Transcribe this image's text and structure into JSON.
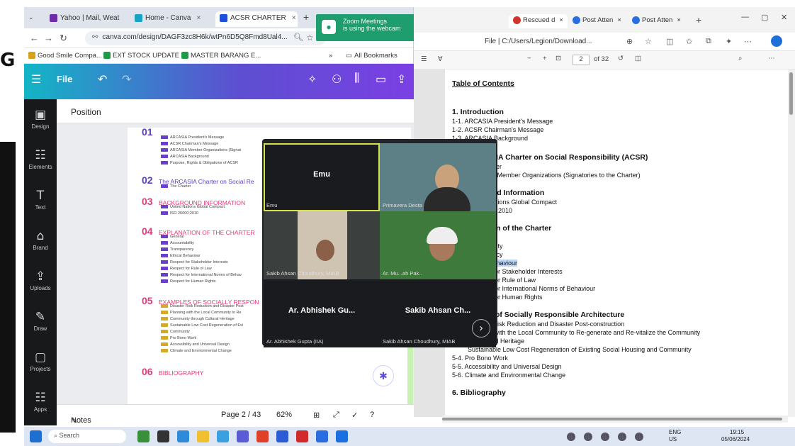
{
  "left_strip": {
    "glyph": "G"
  },
  "chrome": {
    "tabs": [
      {
        "label": "Yahoo | Mail, Weat",
        "icon_color": "#6b2ca8"
      },
      {
        "label": "Home - Canva",
        "icon_color": "#17a3c6"
      },
      {
        "label": "ACSR CHARTER",
        "icon_color": "#1d4fd8"
      }
    ],
    "new_tab": "+",
    "url": "canva.com/design/DAGF3zc8H6k/wtPn6D5Q8Fmd8Ual4...",
    "bookmarks": [
      {
        "label": "Good Smile Compa...",
        "icon_color": "#d9a01a"
      },
      {
        "label": "EXT STOCK UPDATE ...",
        "icon_color": "#1f9a46"
      },
      {
        "label": "MASTER BARANG E...",
        "icon_color": "#1f9a46"
      }
    ],
    "all_bookmarks": "All Bookmarks",
    "bookmarks_more": "»"
  },
  "zoom_notification": {
    "line1": "Zoom Meetings",
    "line2": "is using the webcam"
  },
  "canva": {
    "file_label": "File",
    "panel_title": "Position",
    "side": [
      {
        "label": "Design",
        "glyph": "▣"
      },
      {
        "label": "Elements",
        "glyph": "☷"
      },
      {
        "label": "Text",
        "glyph": "T"
      },
      {
        "label": "Brand",
        "glyph": "⌂"
      },
      {
        "label": "Uploads",
        "glyph": "⇪"
      },
      {
        "label": "Draw",
        "glyph": "✎"
      },
      {
        "label": "Projects",
        "glyph": "▢"
      },
      {
        "label": "Apps",
        "glyph": "☷"
      }
    ],
    "doc": {
      "s01_num": "01",
      "s01_subs": [
        "ARCASIA President's Message",
        "ACSR Chairman's Message",
        "ARCASIA Member Organizations (Signat",
        "ARCASIA Background",
        "Purpose, Rights & Obligations of ACSR"
      ],
      "s02_num": "02",
      "s02_title": "The ARCASIA Charter on Social Re",
      "s02_subs": [
        "The Charter"
      ],
      "s03_num": "03",
      "s03_title": "BACKGROUND INFORMATION",
      "s03_subs": [
        "United Nations Global Compact",
        "ISO 26000:2010"
      ],
      "s04_num": "04",
      "s04_title": "EXPLANATION OF THE CHARTER",
      "s04_subs": [
        "General",
        "Accountability",
        "Transparency",
        "Ethical Behaviour",
        "Respect for Stakeholder Interests",
        "Respect for Rule of Law",
        "Respect for International Norms of Behav",
        "Respect for Human Rights"
      ],
      "s05_num": "05",
      "s05_title": "EXAMPLES OF SOCIALLY RESPON",
      "s05_subs": [
        "Disaster Risk Reduction and Disaster Post",
        "Planning with the Local Community to Re",
        "Community through Cultural Heritage",
        "Sustainable Low Cost Regeneration of Exi",
        "Community",
        "Pro Bono Work",
        "Accessibility and Universal Design",
        "Climate and Environmental Change"
      ],
      "s06_num": "06",
      "s06_title": "BIBLIOGRAPHY"
    },
    "notes": "Notes",
    "page_indicator": "Page 2 / 43",
    "zoom": "62%"
  },
  "edge": {
    "tabs": [
      {
        "label": "Rescued d",
        "icon_color": "#d0342c"
      },
      {
        "label": "Post Atten",
        "icon_color": "#2a6de0"
      },
      {
        "label": "Post Atten",
        "icon_color": "#2a6de0"
      }
    ],
    "url": "File  |  C:/Users/Legion/Download...",
    "page_num": "2",
    "page_of": "of 32",
    "pdf": [
      {
        "t": "Table of Contents",
        "h": true,
        "u": true
      },
      {
        "t": "1. Introduction",
        "h": true
      },
      {
        "t": "1-1. ARCASIA President's Message"
      },
      {
        "t": "1-2. ACSR Chairman's Message"
      },
      {
        "t": "1-3. ARCASIA Background"
      },
      {
        "t": "he ARCASIA Charter on Social Responsibility (ACSR)",
        "h": true
      },
      {
        "t": "The Charter"
      },
      {
        "t": "ARCASIA Member Organizations (Signatories to the Charter)"
      },
      {
        "t": "ackground Information",
        "h": true
      },
      {
        "t": "United Nations Global Compact"
      },
      {
        "t": "SO 26000:2010"
      },
      {
        "t": "xplanation of the Charter",
        "h": true
      },
      {
        "t": "General"
      },
      {
        "t": "ccountability"
      },
      {
        "t": "ransparency"
      },
      {
        "t": "Ethical Behaviour",
        "hl": true
      },
      {
        "t": "Respect for Stakeholder Interests"
      },
      {
        "t": "Respect for Rule of Law"
      },
      {
        "t": "Respect for International Norms of Behaviour"
      },
      {
        "t": "Respect for Human Rights"
      },
      {
        "t": "xamples of Socially Responsible Architecture",
        "h": true
      },
      {
        "t": "Disaster Risk Reduction and Disaster Post-construction"
      },
      {
        "t": "Planning with the Local Community to Re-generate and Re-vitalize the Community"
      },
      {
        "t": "gh Cultural Heritage"
      },
      {
        "t": "Sustainable Low Cost Regeneration of Existing Social Housing and Community"
      },
      {
        "t": "5-4. Pro Bono Work"
      },
      {
        "t": "5-5. Accessibility and Universal Design"
      },
      {
        "t": "5-6. Climate and Environmental Change"
      },
      {
        "t": "6. Bibliography",
        "h": true
      }
    ]
  },
  "gallery": {
    "tiles": [
      {
        "big": "Emu",
        "name": "Emu",
        "kind": "blank",
        "active": true
      },
      {
        "big": "",
        "name": "Primavera Desta",
        "kind": "video"
      },
      {
        "big": "",
        "name": "Sakib Ahsan Choudhury, MIAB",
        "kind": "video"
      },
      {
        "big": "",
        "name": "Ar. Mu...ah Pak..",
        "kind": "video"
      },
      {
        "big": "Ar. Abhishek Gu...",
        "name": "Ar. Abhishek Gupta (IIA)",
        "kind": "blank"
      },
      {
        "big": "Sakib Ahsan Ch...",
        "name": "Sakib Ahsan Choudhury, MIAB",
        "kind": "blank"
      }
    ],
    "next": "›"
  },
  "taskbar": {
    "search": "Search",
    "lang1": "ENG",
    "lang2": "US",
    "time": "19:15",
    "date": "05/06/2024"
  }
}
